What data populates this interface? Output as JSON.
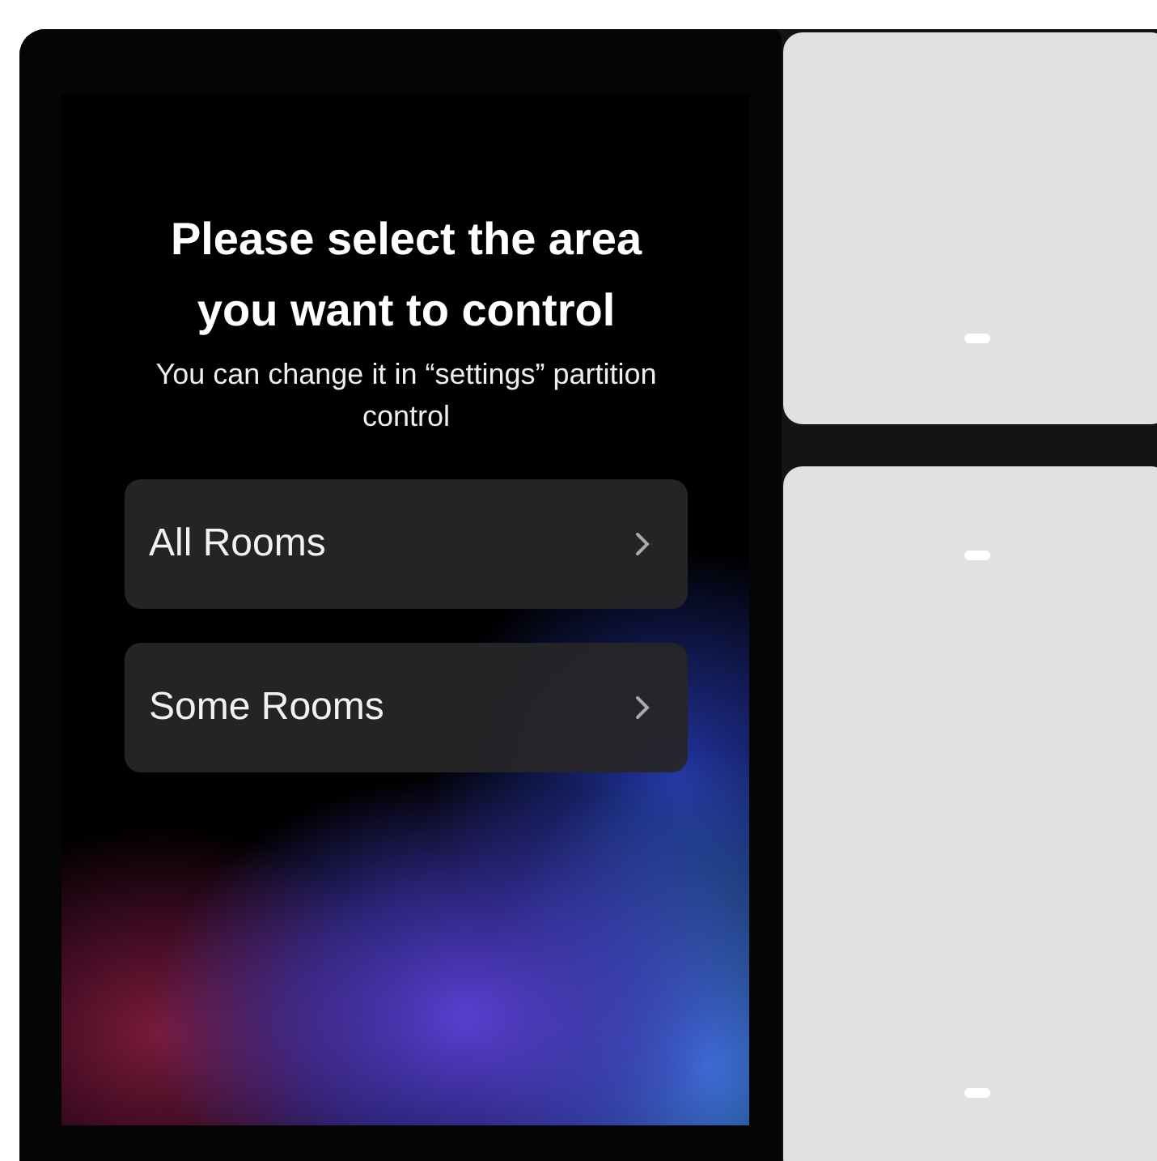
{
  "screen": {
    "title": "Please select the area you want to control",
    "subtitle": "You can change it in “settings” partition control",
    "options": [
      {
        "label": "All Rooms"
      },
      {
        "label": "Some Rooms"
      }
    ]
  },
  "keys": [
    {
      "kind": "short"
    },
    {
      "kind": "tall"
    }
  ]
}
